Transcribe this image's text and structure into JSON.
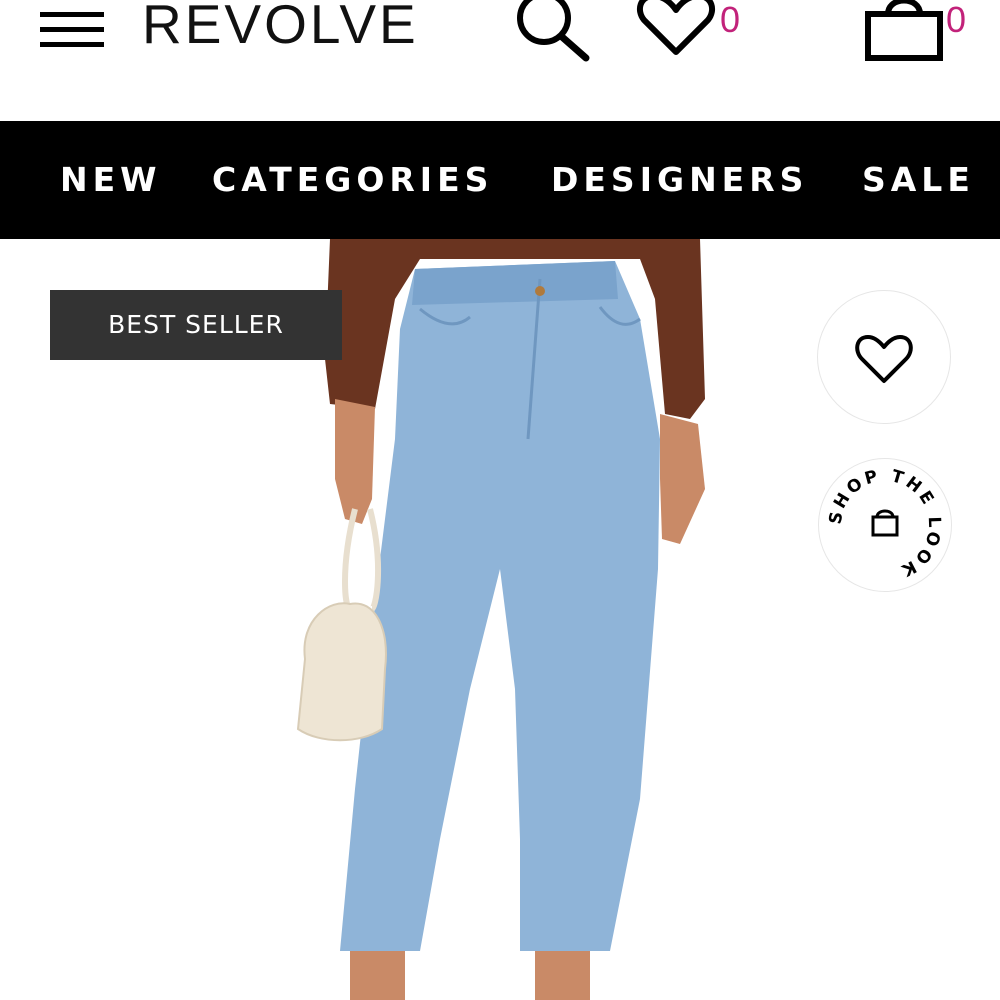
{
  "header": {
    "logo_text": "REVOLVE",
    "wishlist_count": "0",
    "bag_count": "0",
    "count_color": "#c2227a"
  },
  "nav": {
    "items": [
      "NEW",
      "CATEGORIES",
      "DESIGNERS",
      "SALE"
    ]
  },
  "product": {
    "badge": "BEST SELLER",
    "shop_the_look": "SHOP THE LOOK",
    "icons": [
      "heart-icon",
      "bag-icon"
    ]
  }
}
